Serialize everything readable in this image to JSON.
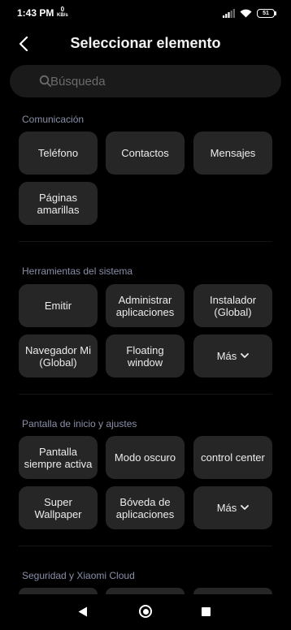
{
  "status_bar": {
    "time": "1:43 PM",
    "net_speed_value": "0",
    "net_speed_unit": "KB/s",
    "battery": "51",
    "icons": [
      "signal-icon",
      "wifi-icon",
      "battery-icon"
    ]
  },
  "header": {
    "back_icon": "chevron-left-icon",
    "title": "Seleccionar elemento"
  },
  "search": {
    "placeholder": "Búsqueda",
    "value": ""
  },
  "sections": [
    {
      "title": "Comunicación",
      "items": [
        {
          "label": "Teléfono"
        },
        {
          "label": "Contactos"
        },
        {
          "label": "Mensajes"
        },
        {
          "label": "Páginas\namarillas"
        }
      ]
    },
    {
      "title": "Herramientas del sistema",
      "items": [
        {
          "label": "Emitir"
        },
        {
          "label": "Administrar\naplicaciones"
        },
        {
          "label": "Instalador\n(Global)"
        },
        {
          "label": "Navegador Mi\n(Global)"
        },
        {
          "label": "Floating\nwindow"
        },
        {
          "label": "Más"
        }
      ]
    },
    {
      "title": "Pantalla de inicio y ajustes",
      "items": [
        {
          "label": "Pantalla\nsiempre activa"
        },
        {
          "label": "Modo oscuro"
        },
        {
          "label": "control center"
        },
        {
          "label": "Super\nWallpaper"
        },
        {
          "label": "Bóveda de\naplicaciones"
        },
        {
          "label": "Más"
        }
      ]
    },
    {
      "title": "Seguridad y Xiaomi Cloud",
      "items": []
    }
  ],
  "nav_bar": {
    "icons": [
      "back-triangle-icon",
      "home-circle-icon",
      "recents-square-icon"
    ]
  },
  "colors": {
    "background": "#000000",
    "tile": "#262626",
    "search": "#1a1a1a",
    "section_title": "#8a8fa8"
  }
}
